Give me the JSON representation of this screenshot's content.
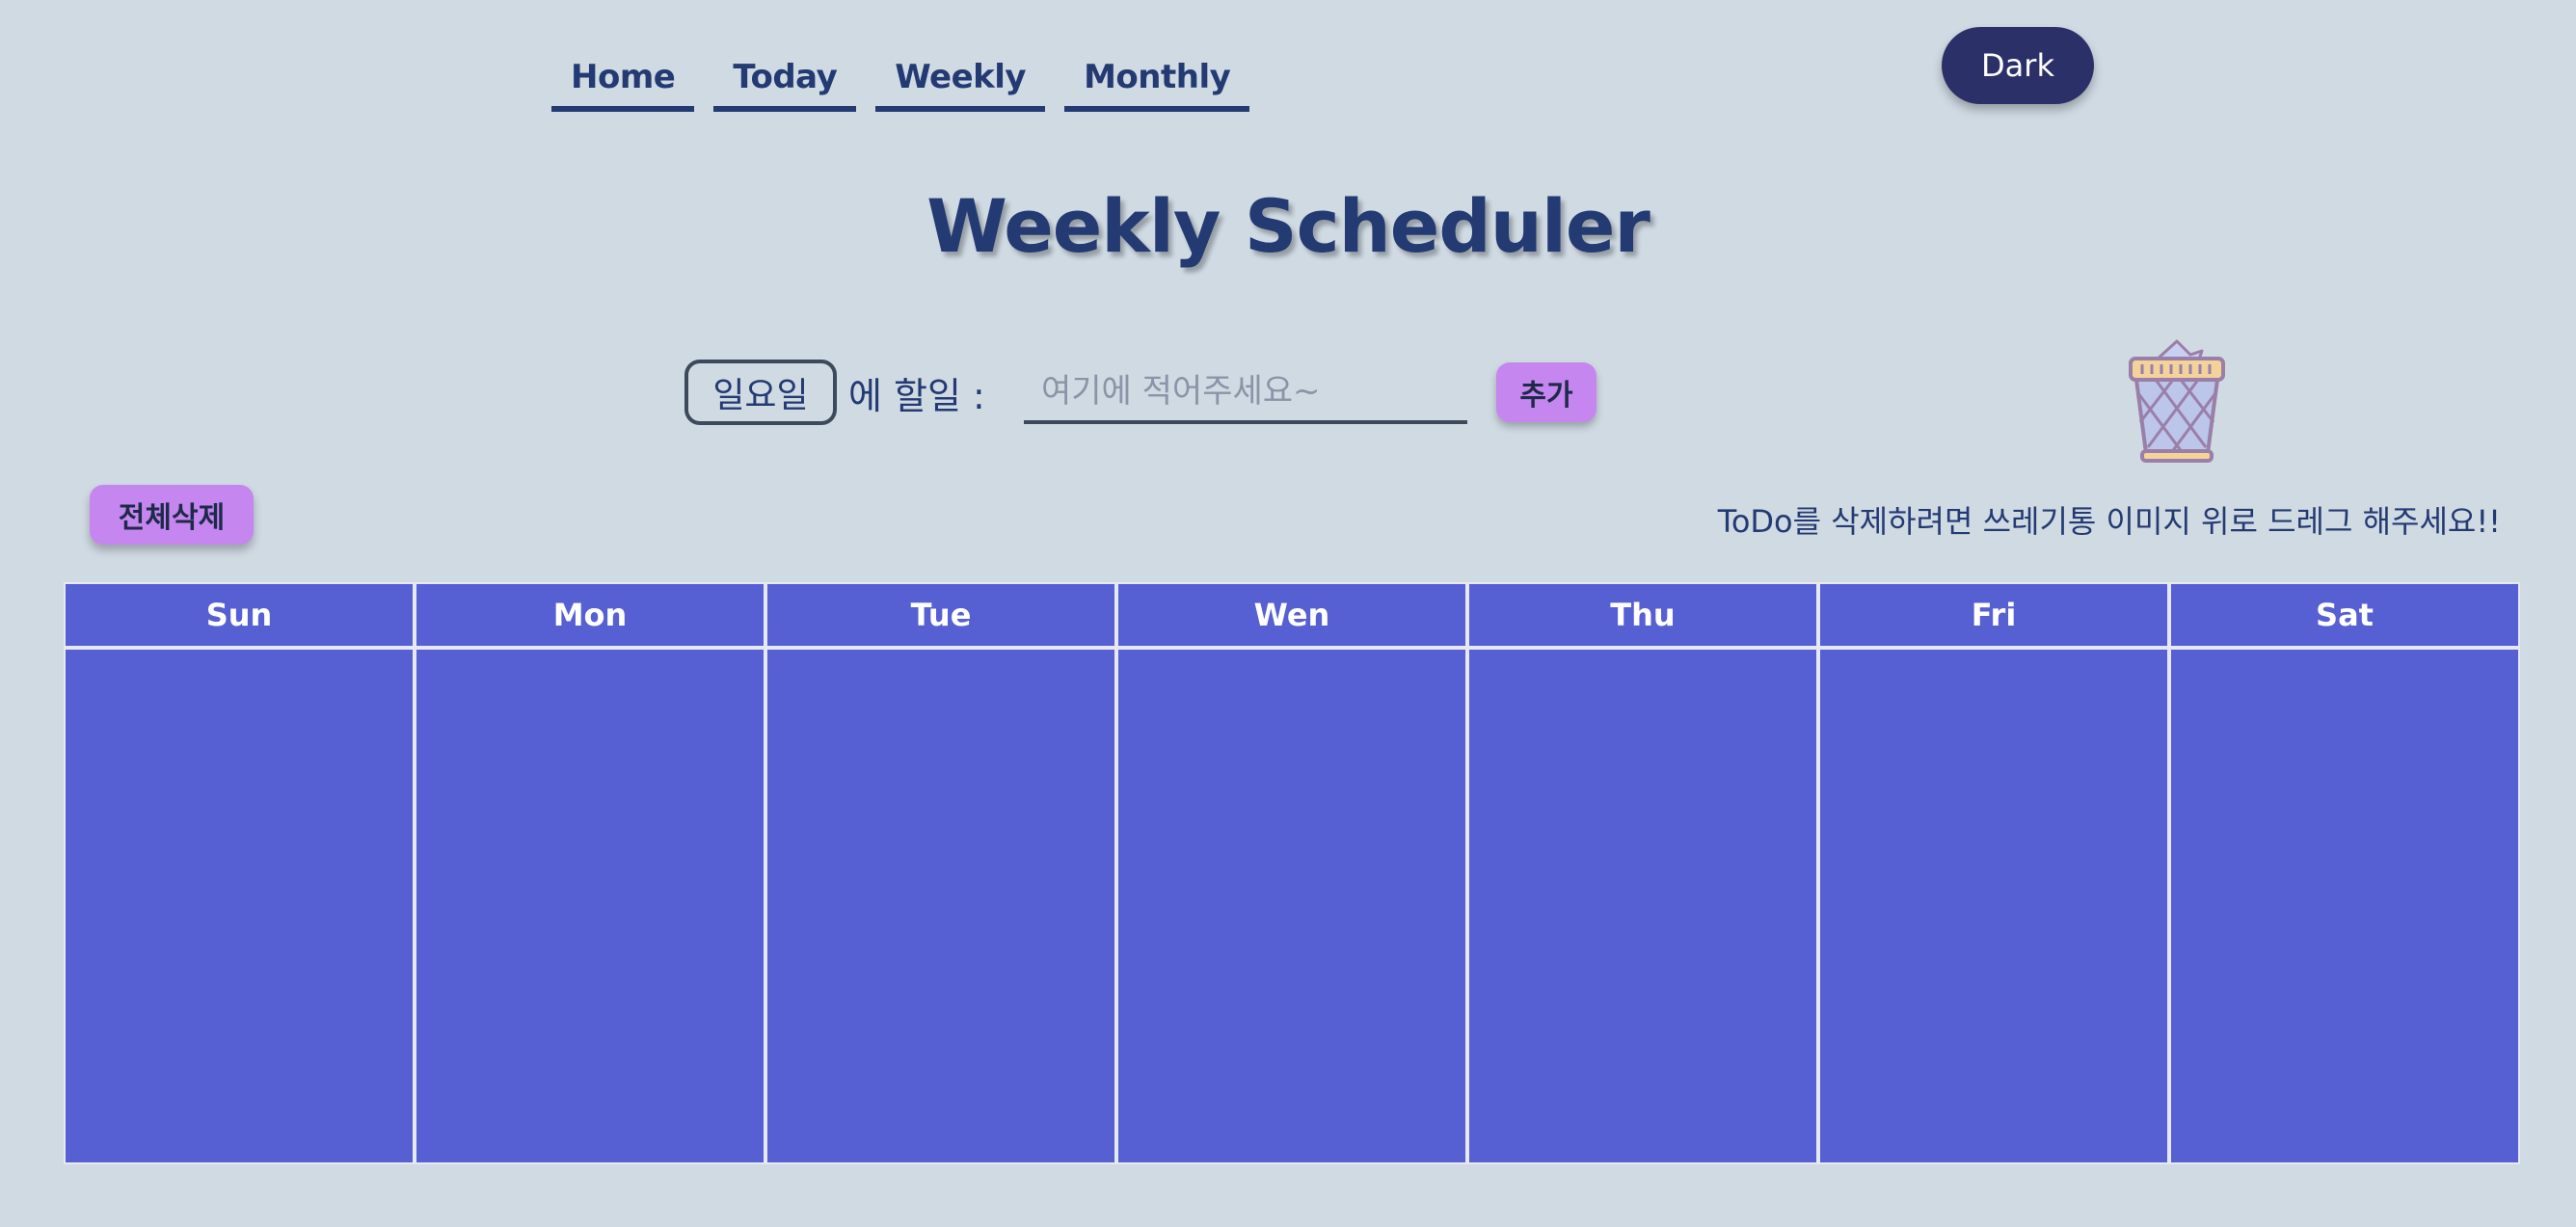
{
  "nav": {
    "items": [
      {
        "label": "Home"
      },
      {
        "label": "Today"
      },
      {
        "label": "Weekly"
      },
      {
        "label": "Monthly"
      }
    ]
  },
  "theme_toggle": {
    "label": "Dark"
  },
  "title": "Weekly Scheduler",
  "form": {
    "day_selected": "일요일",
    "todo_label": "에 할일 :",
    "input_placeholder": "여기에 적어주세요~",
    "input_value": "",
    "add_label": "추가"
  },
  "delete_all_label": "전체삭제",
  "trash_hint": "ToDo를 삭제하려면 쓰레기통 이미지 위로 드레그 해주세요!!",
  "trash_icon": "trash-bin-icon",
  "week": {
    "days": [
      "Sun",
      "Mon",
      "Tue",
      "Wen",
      "Thu",
      "Fri",
      "Sat"
    ]
  },
  "colors": {
    "background": "#d0dae3",
    "text": "#233a72",
    "accent_button": "#c586f0",
    "dark_button": "#2c3068",
    "grid_fill": "#5760d2"
  }
}
